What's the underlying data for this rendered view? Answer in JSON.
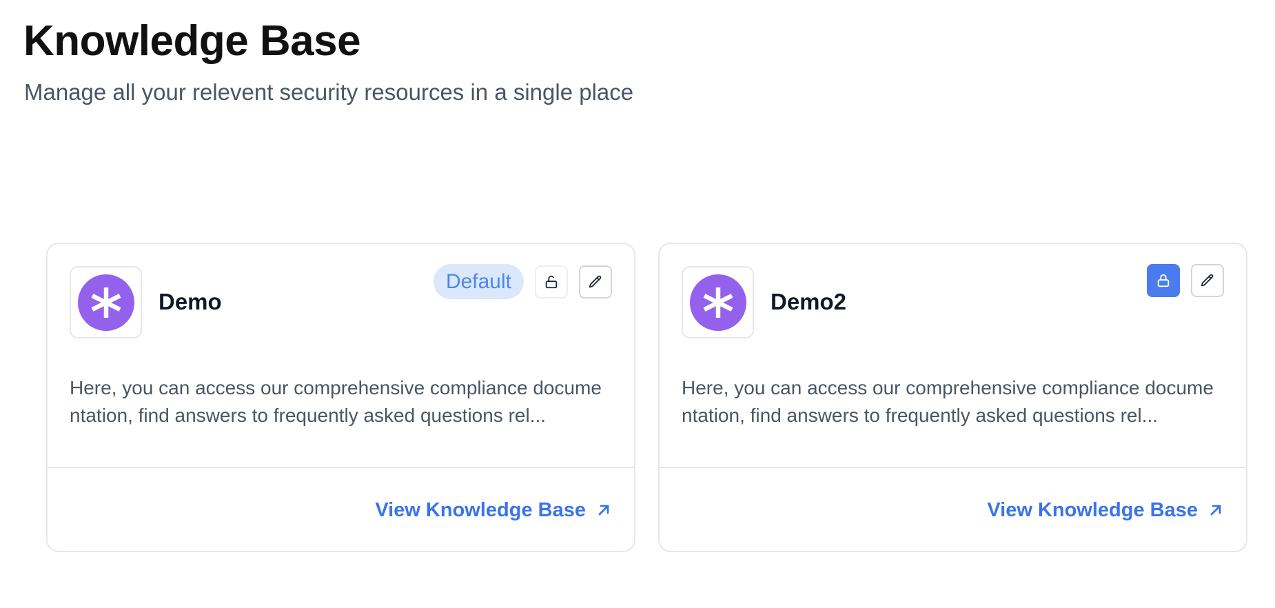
{
  "header": {
    "title": "Knowledge Base",
    "subtitle": "Manage all your relevent security resources in a single place"
  },
  "colors": {
    "accent": "#3b74e8",
    "logo": "#9461ec",
    "badge_bg": "#dbe7fb",
    "lock_active": "#4a7cf0"
  },
  "cards": [
    {
      "name": "Demo",
      "badge": "Default",
      "locked": false,
      "description": "Here, you can access our comprehensive compliance documentation, find answers to frequently asked questions rel...",
      "link_label": "View Knowledge Base",
      "icons": [
        "asterisk-logo-icon",
        "unlock-icon",
        "pencil-icon",
        "arrow-up-right-icon"
      ]
    },
    {
      "name": "Demo2",
      "badge": "",
      "locked": true,
      "description": "Here, you can access our comprehensive compliance documentation, find answers to frequently asked questions rel...",
      "link_label": "View Knowledge Base",
      "icons": [
        "asterisk-logo-icon",
        "lock-icon",
        "pencil-icon",
        "arrow-up-right-icon"
      ]
    }
  ]
}
